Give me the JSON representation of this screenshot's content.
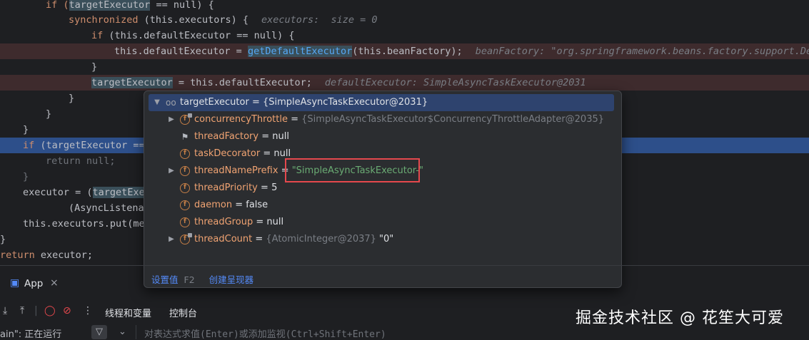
{
  "editor": {
    "line1": {
      "a": "if (",
      "var": "targetExecutor",
      "b": " == null) {"
    },
    "line2": {
      "kw": "synchronized",
      "b": " (this.executors) {",
      "hint": "executors:  size = 0"
    },
    "line3": {
      "kw": "if",
      "b": " (this.defaultExecutor == null) {"
    },
    "line4": {
      "a": "this.defaultExecutor = ",
      "fn": "getDefaultExecutor",
      "b": "(this.beanFactory);",
      "hint": "beanFactory: \"org.springframework.beans.factory.support.Def"
    },
    "line5": {
      "a": "}"
    },
    "line6": {
      "var": "targetExecutor",
      "b": " = this.defaultExecutor;",
      "hint": "defaultExecutor: SimpleAsyncTaskExecutor@2031"
    },
    "line7": {
      "a": "}"
    },
    "line8": {
      "a": "}"
    },
    "line9": {
      "a": "}"
    },
    "line10": {
      "kw": "if",
      "b": " (targetExecutor =="
    },
    "line11": {
      "kw": "return",
      "b": " null;"
    },
    "line12": {
      "a": "}"
    },
    "line13": {
      "a": "executor = (",
      "var": "targetExe"
    },
    "line14": {
      "a": "(AsyncListena"
    },
    "line15": {
      "a": "this.executors.put(me"
    },
    "line16": {
      "a": "}"
    },
    "line17": {
      "kw": "return",
      "b": " executor;"
    }
  },
  "popup": {
    "root": {
      "name": "targetExecutor",
      "value": "{SimpleAsyncTaskExecutor@2031}"
    },
    "fields": [
      {
        "name": "concurrencyThrottle",
        "eq": " = ",
        "value": "{SimpleAsyncTaskExecutor$ConcurrencyThrottleAdapter@2035}",
        "extra": ""
      },
      {
        "name": "threadFactory",
        "eq": " = ",
        "value": "null",
        "extra": ""
      },
      {
        "name": "taskDecorator",
        "eq": " = ",
        "value": "null",
        "extra": ""
      },
      {
        "name": "threadNamePrefix",
        "eq": " = ",
        "value": "\"SimpleAsyncTaskExecutor-\"",
        "extra": ""
      },
      {
        "name": "threadPriority",
        "eq": " = ",
        "value": "5",
        "extra": ""
      },
      {
        "name": "daemon",
        "eq": " = ",
        "value": "false",
        "extra": ""
      },
      {
        "name": "threadGroup",
        "eq": " = ",
        "value": "null",
        "extra": ""
      },
      {
        "name": "threadCount",
        "eq": " = ",
        "value": "{AtomicInteger@2037}",
        "extra": " \"0\""
      }
    ],
    "footer": {
      "set_value": "设置值",
      "set_value_key": "F2",
      "create_renderer": "创建呈现器"
    }
  },
  "bottom": {
    "app_tab": "App",
    "tabs": [
      "线程和变量",
      "控制台"
    ],
    "thread_label": "ain\": 正在运行",
    "eval_placeholder": "对表达式求值(Enter)或添加监视(Ctrl+Shift+Enter)"
  },
  "watermark": "掘金技术社区 @ 花笙大可爱"
}
